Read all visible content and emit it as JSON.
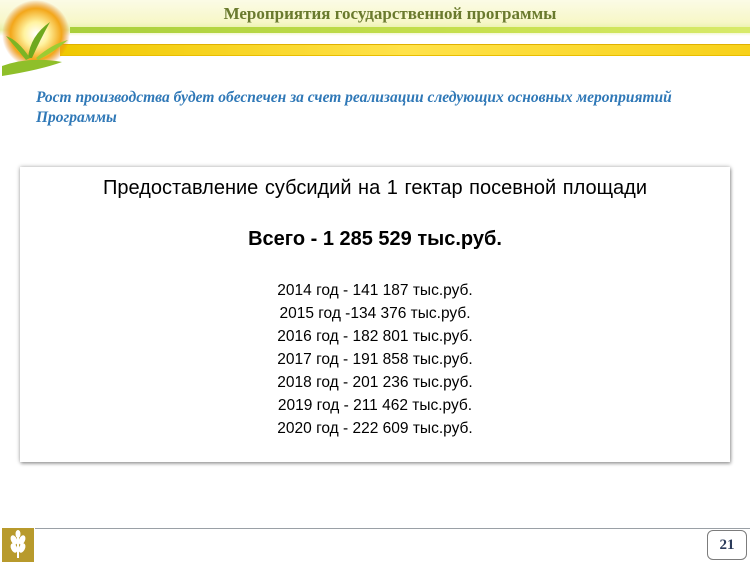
{
  "header": {
    "title": "Мероприятия государственной программы"
  },
  "subtitle": "Рост производства будет обеспечен за счет реализации следующих основных мероприятий Программы",
  "card": {
    "heading": "Предоставление субсидий на 1 гектар посевной площади",
    "total": "Всего - 1 285 529 тыс.руб.",
    "years": [
      "2014 год - 141 187 тыс.руб.",
      "2015 год -134 376 тыс.руб.",
      "2016 год - 182 801 тыс.руб.",
      "2017 год - 191 858 тыс.руб.",
      "2018 год - 201 236 тыс.руб.",
      "2019 год - 211 462 тыс.руб.",
      "2020 год - 222 609 тыс.руб."
    ]
  },
  "footer": {
    "page_number": "21",
    "logo_icon": "wheat-icon"
  },
  "colors": {
    "title": "#6a7a2e",
    "subtitle": "#2f78b7",
    "accent_green": "#a9cf3b",
    "accent_yellow": "#f7d11a"
  }
}
